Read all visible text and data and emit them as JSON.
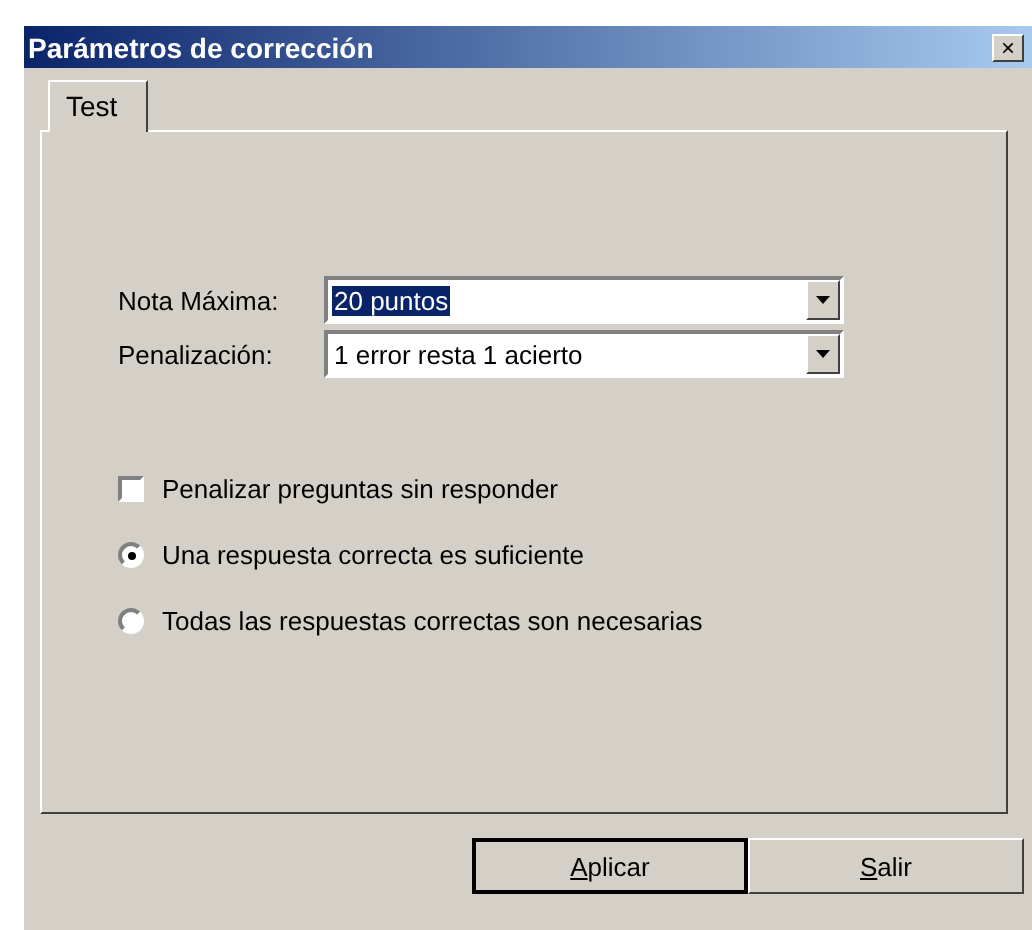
{
  "window": {
    "title": "Parámetros de corrección",
    "close_glyph": "×"
  },
  "tabs": [
    {
      "label": "Test",
      "selected": true
    }
  ],
  "fields": [
    {
      "label": "Nota Máxima:",
      "value": "20 puntos",
      "text_selected": true
    },
    {
      "label": "Penalización:",
      "value": "1 error resta 1 acierto",
      "text_selected": false
    }
  ],
  "options": [
    {
      "kind": "checkbox",
      "label": "Penalizar preguntas sin responder",
      "checked": false
    },
    {
      "kind": "radio",
      "label": "Una respuesta correcta es suficiente",
      "selected": true
    },
    {
      "kind": "radio",
      "label": "Todas las respuestas correctas son necesarias",
      "selected": false
    }
  ],
  "buttons": [
    {
      "label": "Aplicar",
      "default": true
    },
    {
      "label": "Salir",
      "default": false
    }
  ]
}
